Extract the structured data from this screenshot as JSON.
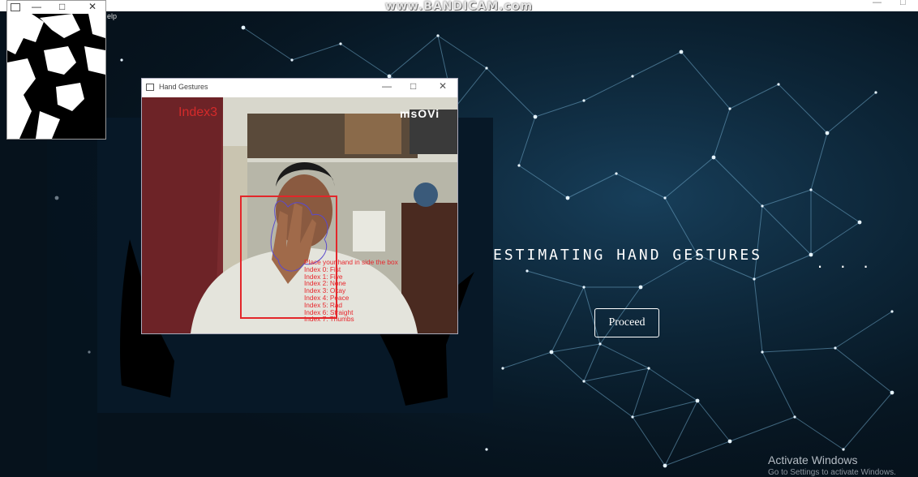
{
  "watermark": "www.BANDICAM.com",
  "main_window": {
    "menu_help": "elp",
    "minimize": "—",
    "restore": "□"
  },
  "headline": "ESTIMATING HAND GESTURES",
  "headline_dots": ". . .",
  "proceed_label": "Proceed",
  "activate": {
    "title": "Activate Windows",
    "subtitle": "Go to Settings to activate Windows."
  },
  "mask_window": {
    "minimize": "—",
    "maximize": "□",
    "close": "✕"
  },
  "hand_window": {
    "title": "Hand Gestures",
    "minimize": "—",
    "maximize": "□",
    "close": "✕",
    "index_label": "Index3",
    "brand": "msOVi",
    "instruction": "Place your hand in side the box",
    "gestures": [
      "Index 0: Fist",
      "Index 1: Five",
      "Index 2: None",
      "Index 3: Okay",
      "Index 4: Peace",
      "Index 5: Rad",
      "Index 6: Straight",
      "Index 7: Thumbs"
    ]
  },
  "colors": {
    "background": "#06121c",
    "panel": "#071827",
    "accent_red": "#e3262a",
    "network_line": "#6fa8c9"
  }
}
